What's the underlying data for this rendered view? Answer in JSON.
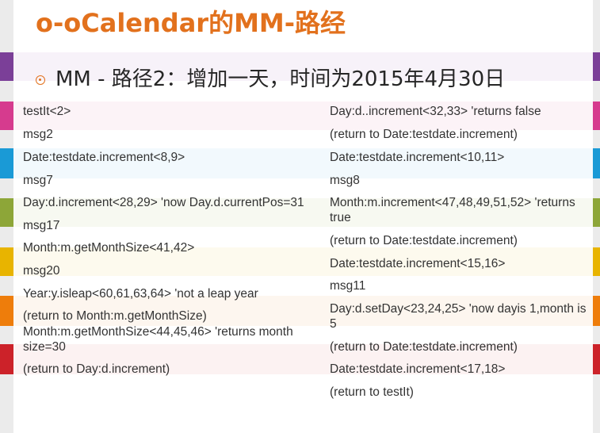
{
  "slide": {
    "title": "o-oCalendar的MM-路经",
    "bullet": "MM - 路径2：增加一天，时间为2015年4月30日"
  },
  "steps": {
    "left": [
      "testIt<2>",
      "msg2",
      "Date:testdate.increment<8,9>",
      "msg7",
      "Day:d.increment<28,29> 'now Day.d.currentPos=31",
      "msg17",
      "Month:m.getMonthSize<41,42>",
      "msg20",
      "Year:y.isleap<60,61,63,64> 'not a leap year",
      "(return to Month:m.getMonthSize)",
      "Month:m.getMonthSize<44,45,46> 'returns month size=30",
      "(return to Day:d.increment)"
    ],
    "right": [
      "Day:d..increment<32,33> 'returns false",
      "(return to Date:testdate.increment)",
      "Date:testdate.increment<10,11>",
      "msg8",
      "Month:m.increment<47,48,49,51,52> 'returns true",
      "(return to Date:testdate.increment)",
      "Date:testdate.increment<15,16>",
      "msg11",
      "Day:d.setDay<23,24,25> 'now dayis 1,month is 5",
      "(return to Date:testdate.increment)",
      "Date:testdate.increment<17,18>",
      "(return to testIt)"
    ]
  },
  "theme": {
    "title_color": "#e2711d",
    "stripe_colors": [
      "#7b3f98",
      "#d63b8e",
      "#1a9ad6",
      "#8da638",
      "#e8b400",
      "#ee7d0b",
      "#cc2229"
    ]
  }
}
